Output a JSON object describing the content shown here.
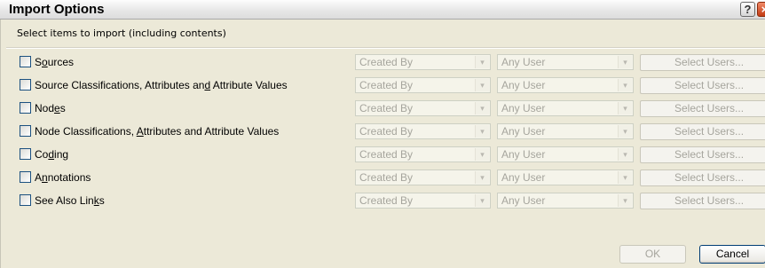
{
  "window": {
    "title": "Import Options",
    "help_label": "?",
    "close_label": "×"
  },
  "prompt": "Select items to import (including contents)",
  "rows": [
    {
      "label": "Sources",
      "mnemonic_index": 1,
      "checked": false,
      "created_by": "Created By",
      "user": "Any User",
      "select_users": "Select Users..."
    },
    {
      "label": "Source Classifications, Attributes and Attribute Values",
      "mnemonic_index": 37,
      "checked": false,
      "created_by": "Created By",
      "user": "Any User",
      "select_users": "Select Users..."
    },
    {
      "label": "Nodes",
      "mnemonic_index": 3,
      "checked": false,
      "created_by": "Created By",
      "user": "Any User",
      "select_users": "Select Users..."
    },
    {
      "label": "Node Classifications, Attributes and Attribute Values",
      "mnemonic_index": 22,
      "checked": false,
      "created_by": "Created By",
      "user": "Any User",
      "select_users": "Select Users..."
    },
    {
      "label": "Coding",
      "mnemonic_index": 2,
      "checked": false,
      "created_by": "Created By",
      "user": "Any User",
      "select_users": "Select Users..."
    },
    {
      "label": "Annotations",
      "mnemonic_index": 1,
      "checked": false,
      "created_by": "Created By",
      "user": "Any User",
      "select_users": "Select Users..."
    },
    {
      "label": "See Also Links",
      "mnemonic_index": 12,
      "checked": false,
      "created_by": "Created By",
      "user": "Any User",
      "select_users": "Select Users..."
    }
  ],
  "buttons": {
    "ok": "OK",
    "cancel": "Cancel"
  }
}
